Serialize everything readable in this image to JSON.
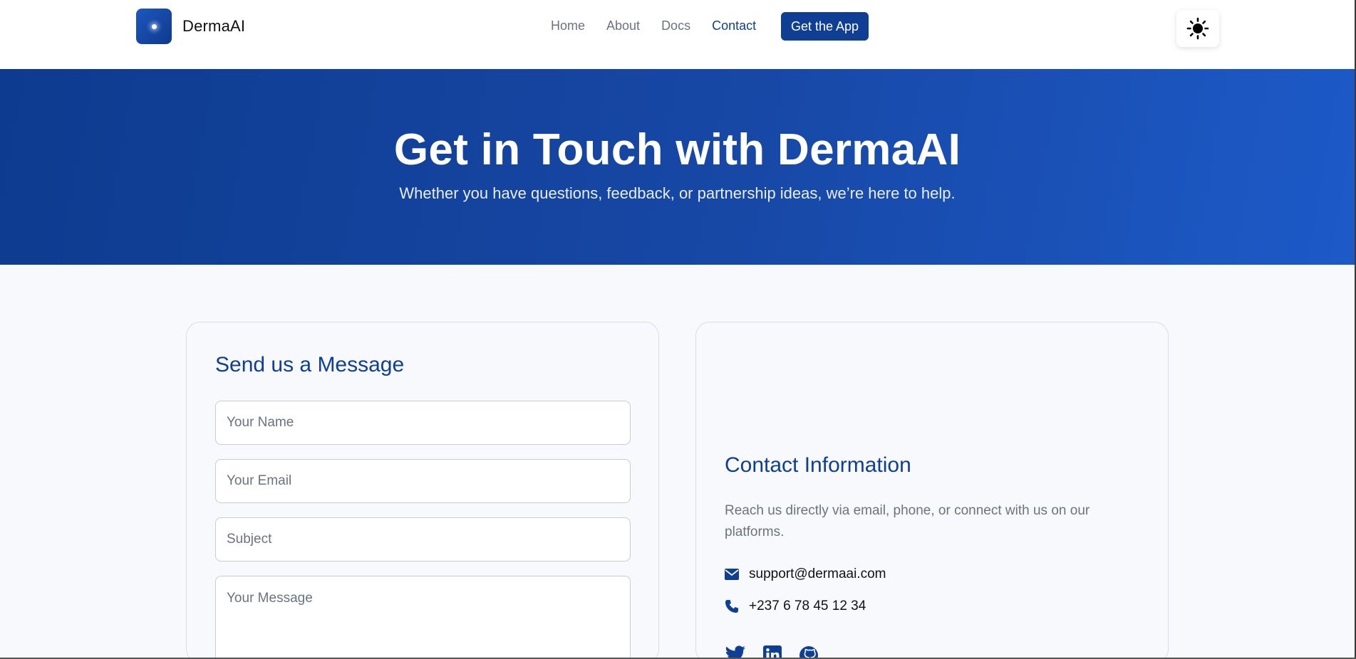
{
  "header": {
    "brand": "DermaAI",
    "nav": [
      {
        "label": "Home",
        "active": false
      },
      {
        "label": "About",
        "active": false
      },
      {
        "label": "Docs",
        "active": false
      },
      {
        "label": "Contact",
        "active": true
      }
    ],
    "cta_label": "Get the App",
    "theme_icon": "sun-icon"
  },
  "hero": {
    "title": "Get in Touch with DermaAI",
    "subtitle": "Whether you have questions, feedback, or partnership ideas, we’re here to help."
  },
  "form": {
    "title": "Send us a Message",
    "name_placeholder": "Your Name",
    "email_placeholder": "Your Email",
    "subject_placeholder": "Subject",
    "message_placeholder": "Your Message"
  },
  "contact": {
    "title": "Contact Information",
    "description": "Reach us directly via email, phone, or connect with us on our platforms.",
    "email": "support@dermaai.com",
    "phone": "+237 6 78 45 12 34",
    "socials": [
      "twitter-icon",
      "linkedin-icon",
      "github-icon"
    ]
  },
  "colors": {
    "primary": "#0f3f95",
    "hero_start": "#0d3b8f",
    "hero_end": "#1d5ac8"
  }
}
